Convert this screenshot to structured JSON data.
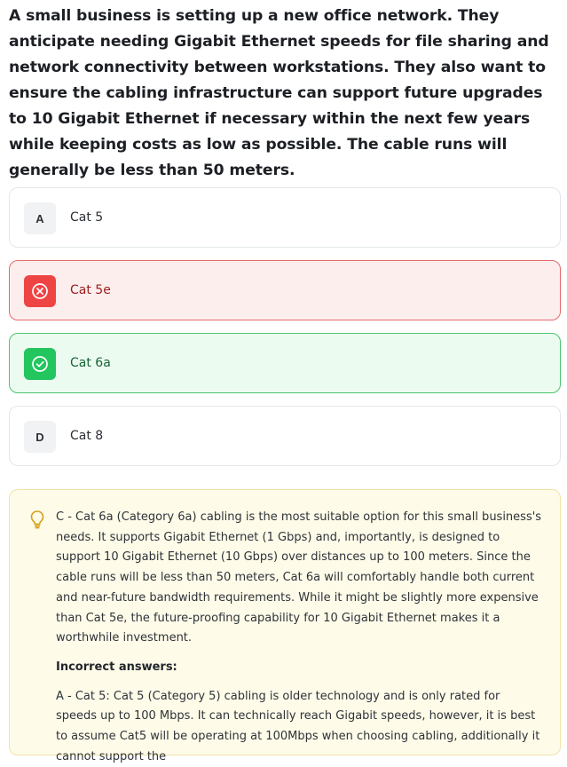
{
  "question": {
    "text": "A small business is setting up a new office network. They anticipate needing Gigabit Ethernet speeds for file sharing and network connectivity between workstations. They also want to ensure the cabling infrastructure can support future upgrades to 10 Gigabit Ethernet if necessary within the next few years while keeping costs as low as possible. The cable runs will generally be less than 50 meters."
  },
  "options": [
    {
      "letter": "A",
      "label": "Cat 5",
      "state": "neutral"
    },
    {
      "letter": "",
      "label": "Cat 5e",
      "state": "incorrect",
      "icon": "x-circle-icon"
    },
    {
      "letter": "",
      "label": "Cat 6a",
      "state": "correct",
      "icon": "check-circle-icon"
    },
    {
      "letter": "D",
      "label": "Cat 8",
      "state": "neutral"
    }
  ],
  "explanation": {
    "icon": "lightbulb-icon",
    "main": "C - Cat 6a (Category 6a) cabling is the most suitable option for this small business's needs. It supports Gigabit Ethernet (1 Gbps) and, importantly, is designed to support 10 Gigabit Ethernet (10 Gbps) over distances up to 100 meters. Since the cable runs will be less than 50 meters, Cat 6a will comfortably handle both current and near-future bandwidth requirements. While it might be slightly more expensive than Cat 5e, the future-proofing capability for 10 Gigabit Ethernet makes it a worthwhile investment.",
    "incorrect_heading": "Incorrect answers:",
    "incorrect_a": "A - Cat 5: Cat 5 (Category 5) cabling is older technology and is only rated for speeds up to 100 Mbps. It can technically reach Gigabit speeds, however, it is best to assume Cat5 will be operating at 100Mbps when choosing cabling, additionally it cannot support the"
  },
  "colors": {
    "incorrect_accent": "#ef4444",
    "incorrect_bg": "#fdeeee",
    "correct_accent": "#22c55e",
    "correct_bg": "#ecfbf0",
    "explanation_bg": "#fefbe9",
    "bulb": "#d4a017"
  }
}
